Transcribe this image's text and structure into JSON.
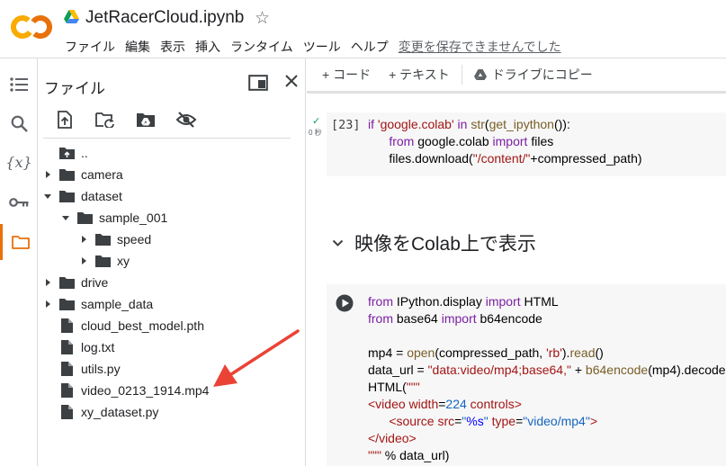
{
  "header": {
    "notebook_title": "JetRacerCloud.ipynb",
    "star_glyph": "☆",
    "menu": [
      "ファイル",
      "編集",
      "表示",
      "挿入",
      "ランタイム",
      "ツール",
      "ヘルプ"
    ],
    "unsaved_notice": "変更を保存できませんでした"
  },
  "colors": {
    "logo_orange": "#f9ab00",
    "logo_dark_orange": "#e8710a",
    "active_rail": "#e8710a",
    "annotation_arrow": "#ea4335"
  },
  "rail": {
    "items": [
      "toc-icon",
      "search-icon",
      "variables-icon",
      "key-icon",
      "folder-icon"
    ],
    "variables_glyph": "{x}",
    "active": "folder-icon"
  },
  "file_panel": {
    "title": "ファイル",
    "tools": [
      "upload-icon",
      "refresh-icon",
      "mount-drive-icon",
      "hide-files-icon"
    ],
    "tree": [
      {
        "name": "..",
        "type": "parent",
        "depth": 0
      },
      {
        "name": "camera",
        "type": "folder",
        "depth": 0,
        "expanded": false
      },
      {
        "name": "dataset",
        "type": "folder",
        "depth": 0,
        "expanded": true
      },
      {
        "name": "sample_001",
        "type": "folder",
        "depth": 1,
        "expanded": true
      },
      {
        "name": "speed",
        "type": "folder",
        "depth": 2,
        "expanded": false
      },
      {
        "name": "xy",
        "type": "folder",
        "depth": 2,
        "expanded": false
      },
      {
        "name": "drive",
        "type": "folder",
        "depth": 0,
        "expanded": false
      },
      {
        "name": "sample_data",
        "type": "folder",
        "depth": 0,
        "expanded": false
      },
      {
        "name": "cloud_best_model.pth",
        "type": "file",
        "depth": 0
      },
      {
        "name": "log.txt",
        "type": "file",
        "depth": 0
      },
      {
        "name": "utils.py",
        "type": "file",
        "depth": 0
      },
      {
        "name": "video_0213_1914.mp4",
        "type": "file",
        "depth": 0
      },
      {
        "name": "xy_dataset.py",
        "type": "file",
        "depth": 0
      }
    ]
  },
  "toolbar": {
    "add_code": "+ コード",
    "add_text": "+ テキスト",
    "copy_to_drive": "ドライブにコピー"
  },
  "cell1": {
    "status_check": "✓",
    "exec_time": "0 秒",
    "exec_count": "[23]"
  },
  "section": {
    "heading": "映像をColab上で表示"
  }
}
